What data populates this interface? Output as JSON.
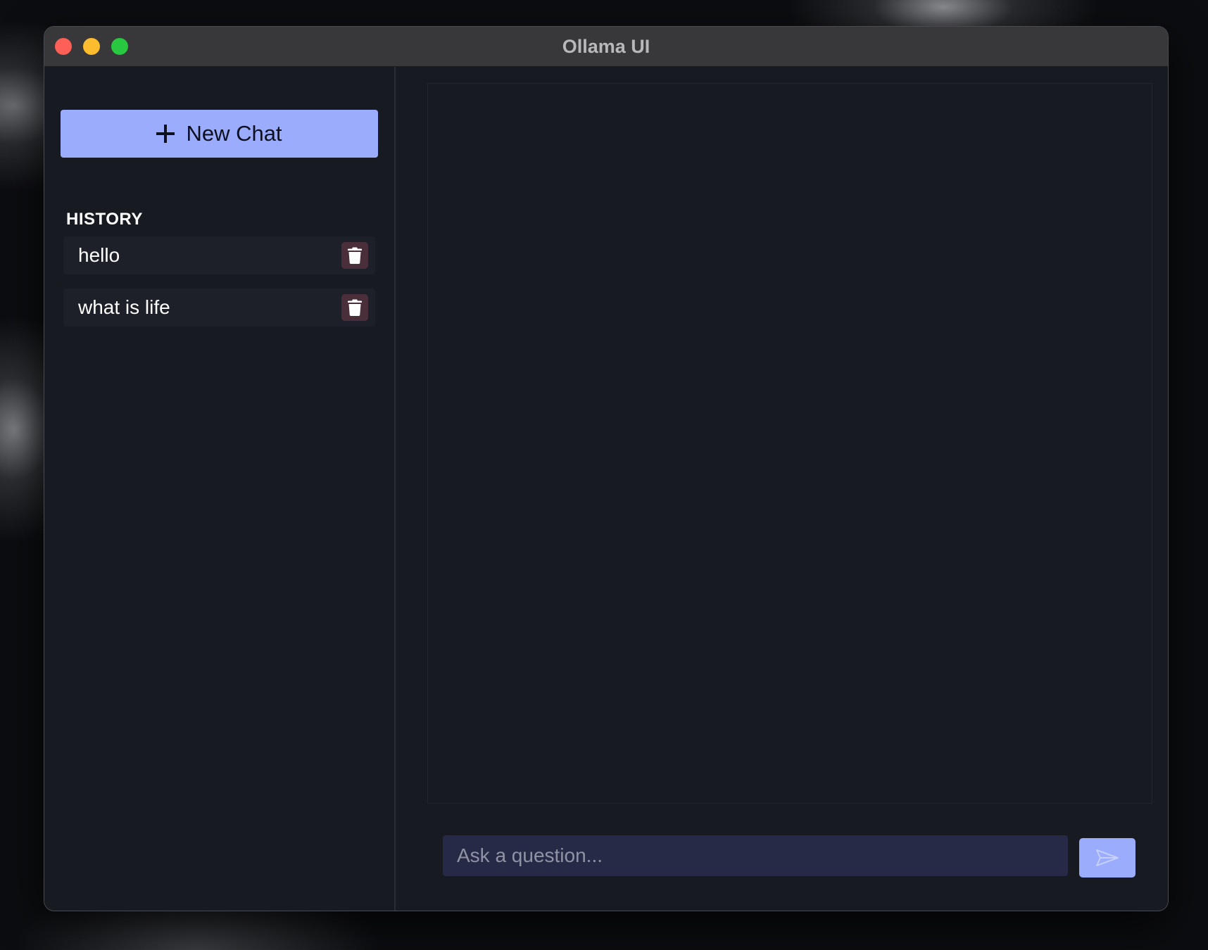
{
  "window": {
    "title": "Ollama UI"
  },
  "sidebar": {
    "new_chat_label": "New Chat",
    "history_heading": "HISTORY",
    "history_items": [
      {
        "label": "hello"
      },
      {
        "label": "what is life"
      }
    ]
  },
  "composer": {
    "placeholder": "Ask a question...",
    "value": ""
  },
  "icons": {
    "new_chat": "plus-icon",
    "delete": "trash-icon",
    "send": "send-icon"
  },
  "colors": {
    "accent": "#9bacfd",
    "background": "#181a22",
    "titlebar": "#38383a",
    "history_item_bg": "#1e2029",
    "delete_button_bg": "#4a2f3a",
    "input_bg": "#262a46",
    "traffic_close": "#fe5f57",
    "traffic_minimize": "#febc2e",
    "traffic_zoom": "#28c840"
  }
}
